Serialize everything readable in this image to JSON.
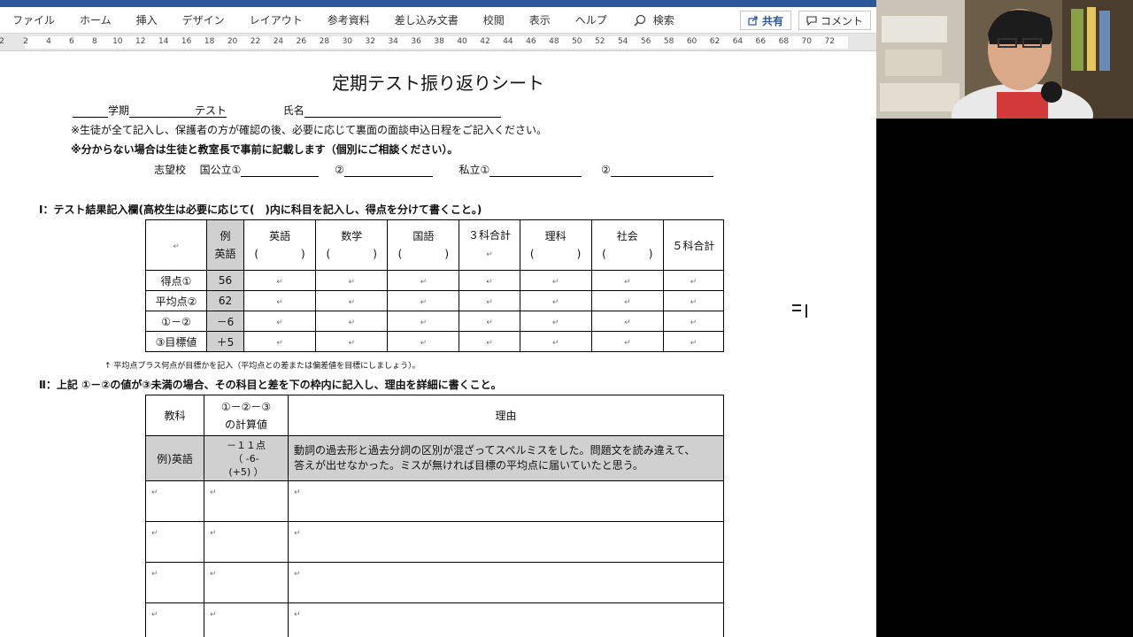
{
  "ribbon": {
    "tabs": [
      "ファイル",
      "ホーム",
      "挿入",
      "デザイン",
      "レイアウト",
      "参考資料",
      "差し込み文書",
      "校閲",
      "表示",
      "ヘルプ"
    ],
    "search_label": "検索",
    "share_label": "共有",
    "comment_label": "コメント"
  },
  "ruler": {
    "numbers": [
      "2",
      "2",
      "4",
      "6",
      "8",
      "10",
      "12",
      "14",
      "16",
      "18",
      "20",
      "22",
      "24",
      "26",
      "28",
      "30",
      "32",
      "34",
      "36",
      "38",
      "40",
      "42",
      "44",
      "46",
      "48",
      "50",
      "52",
      "54",
      "56",
      "58",
      "60",
      "62",
      "64",
      "66",
      "68",
      "70",
      "72"
    ]
  },
  "doc": {
    "title": "定期テスト振り返りシート",
    "semester_label": "学期",
    "test_label": "テスト",
    "name_label": "氏名",
    "note1": "※生徒が全て記入し、保護者の方が確認の後、必要に応じて裏面の面談申込日程をご記入ください。",
    "note2": "※分からない場合は生徒と教室長で事前に記載します（個別にご相談ください）。",
    "school_label": "志望校",
    "public_label": "国公立①",
    "second_label": "②",
    "private_label": "私立①",
    "second_label2": "②",
    "section1": "Ⅰ：テスト結果記入欄(高校生は必要に応じて(　)内に科目を記入し、得点を分けて書くこと。)",
    "section1_note": "↑ 平均点プラス何点が目標かを記入（平均点との差または偏差値を目標にしましょう）。",
    "section2": "Ⅱ：上記 ①－②の値が③未満の場合、その科目と差を下の枠内に記入し、理由を詳細に書くこと。",
    "paragraph_mark": "↵"
  },
  "table1": {
    "example_header": [
      "例",
      "英語"
    ],
    "columns": [
      {
        "name": "英語",
        "paren": "(　　　　)"
      },
      {
        "name": "数学",
        "paren": "(　　　　)"
      },
      {
        "name": "国語",
        "paren": "(　　　　)"
      },
      {
        "name": "３科合計",
        "paren": ""
      },
      {
        "name": "理科",
        "paren": "(　　　　)"
      },
      {
        "name": "社会",
        "paren": "(　　　　)"
      },
      {
        "name": "５科合計",
        "paren": ""
      }
    ],
    "rows": [
      {
        "label": "得点①",
        "example": "56"
      },
      {
        "label": "平均点②",
        "example": "62"
      },
      {
        "label": "①－②",
        "example": "－6"
      },
      {
        "label": "③目標値",
        "example": "＋5"
      }
    ]
  },
  "table2": {
    "headers": [
      "教科",
      "①－②－③",
      "の計算値",
      "理由"
    ],
    "example": {
      "subject": "例)英語",
      "value_line1": "－１１点",
      "value_line2": "（ -6-",
      "value_line3": "(+5) ）",
      "reason_line1": "動詞の過去形と過去分詞の区別が混ざってスペルミスをした。問題文を読み違えて、",
      "reason_line2": "答えが出せなかった。ミスが無ければ目標の平均点に届いていたと思う。"
    },
    "empty_rows": 4
  }
}
